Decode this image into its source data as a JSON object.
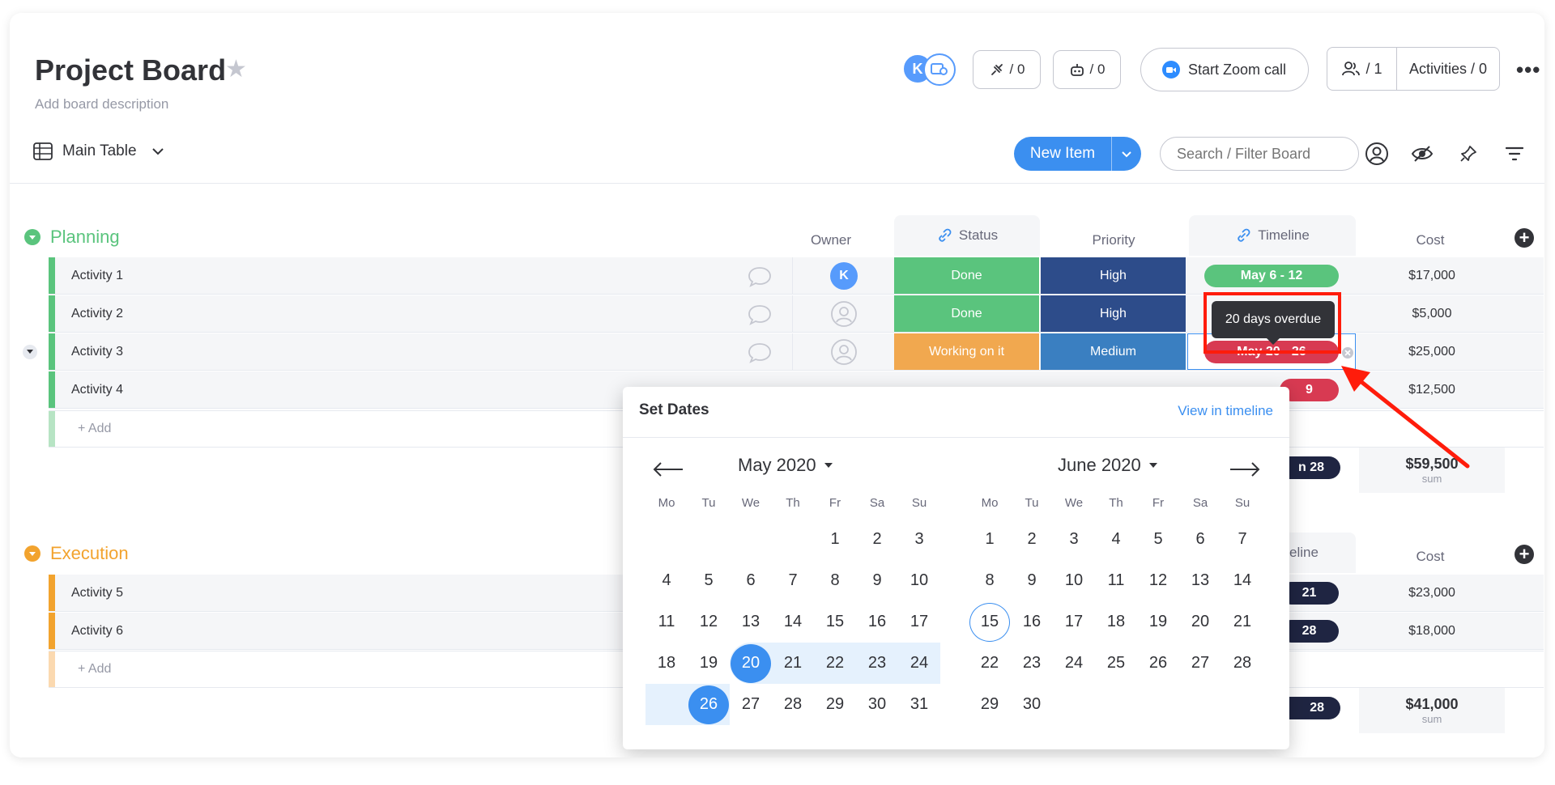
{
  "board": {
    "title": "Project Board",
    "description": "Add board description",
    "avatar_initial": "K",
    "integrations_count": "/ 0",
    "automations_count": "/ 0",
    "zoom_label": "Start Zoom call",
    "members_count": "/ 1",
    "activities_label": "Activities / 0"
  },
  "toolbar": {
    "view_name": "Main Table",
    "new_item_label": "New Item",
    "search_placeholder": "Search / Filter Board"
  },
  "columns": {
    "owner": "Owner",
    "status": "Status",
    "priority": "Priority",
    "timeline": "Timeline",
    "cost": "Cost",
    "timeline_partial": "eline"
  },
  "colors": {
    "done": "#5ac47d",
    "working": "#f1a84f",
    "high": "#2d4c8a",
    "medium": "#3a7fc1",
    "overdue": "#d83a52",
    "dark_pill": "#1f2542",
    "planning": "#5ac47d",
    "execution": "#f2a32e",
    "accent": "#3b8ff0"
  },
  "groups": [
    {
      "name": "Planning",
      "rows": [
        {
          "name": "Activity 1",
          "owner": "K",
          "status": "Done",
          "priority": "High",
          "timeline": "May 6 - 12",
          "cost": "$17,000"
        },
        {
          "name": "Activity 2",
          "owner": "",
          "status": "Done",
          "priority": "High",
          "timeline": "",
          "cost": "$5,000"
        },
        {
          "name": "Activity 3",
          "owner": "",
          "status": "Working on it",
          "priority": "Medium",
          "timeline": "May 20 - 26",
          "cost": "$25,000"
        },
        {
          "name": "Activity 4",
          "owner": "",
          "status": "",
          "priority": "",
          "timeline": "9",
          "cost": "$12,500"
        }
      ],
      "add_label": "+ Add",
      "summary_timeline": "n 28",
      "sum_value": "$59,500",
      "sum_label": "sum"
    },
    {
      "name": "Execution",
      "rows": [
        {
          "name": "Activity 5",
          "timeline": "21",
          "cost": "$23,000"
        },
        {
          "name": "Activity 6",
          "timeline": "28",
          "cost": "$18,000"
        }
      ],
      "add_label": "+ Add",
      "summary_timeline": "28",
      "sum_value": "$41,000",
      "sum_label": "sum"
    }
  ],
  "tooltip": "20 days overdue",
  "date_picker": {
    "title": "Set Dates",
    "link": "View in timeline",
    "left_month": "May 2020",
    "right_month": "June 2020",
    "weekdays": [
      "Mo",
      "Tu",
      "We",
      "Th",
      "Fr",
      "Sa",
      "Su"
    ],
    "selected_start": 20,
    "selected_end": 26,
    "today_june": 15
  }
}
